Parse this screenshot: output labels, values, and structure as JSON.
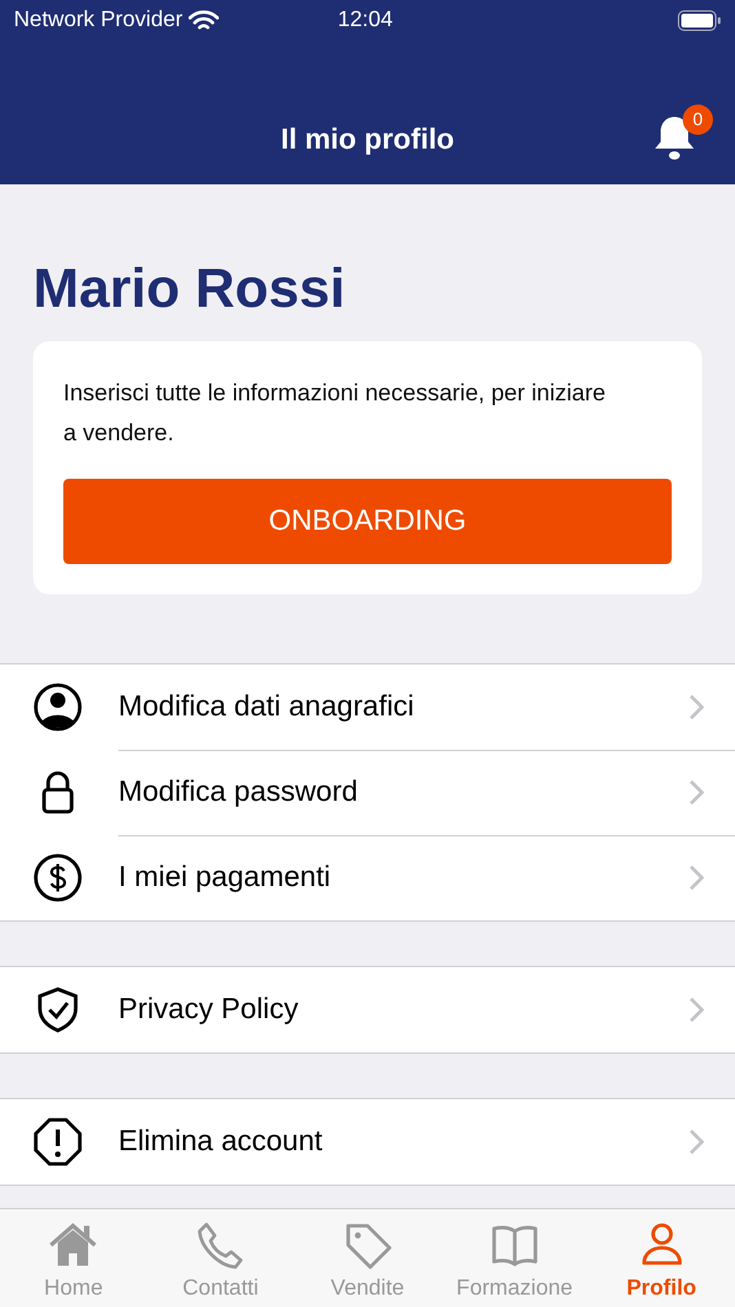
{
  "status_bar": {
    "carrier": "Network Provider",
    "time": "12:04"
  },
  "header": {
    "title": "Il mio profilo",
    "notification_count": "0"
  },
  "profile": {
    "name": "Mario Rossi"
  },
  "onboarding_card": {
    "text": "Inserisci tutte le informazioni necessarie, per iniziare a vendere.",
    "button": "ONBOARDING"
  },
  "menu_sections": [
    {
      "items": [
        {
          "kind": "person",
          "label": "Modifica dati anagrafici"
        },
        {
          "kind": "lock",
          "label": "Modifica password"
        },
        {
          "kind": "dollar",
          "label": "I miei pagamenti"
        }
      ]
    },
    {
      "items": [
        {
          "kind": "shield",
          "label": "Privacy Policy"
        }
      ]
    },
    {
      "items": [
        {
          "kind": "alert",
          "label": "Elimina account"
        }
      ]
    }
  ],
  "tab_bar": [
    {
      "kind": "home",
      "label": "Home",
      "selected": false
    },
    {
      "kind": "phone",
      "label": "Contatti",
      "selected": false
    },
    {
      "kind": "tag",
      "label": "Vendite",
      "selected": false
    },
    {
      "kind": "book",
      "label": "Formazione",
      "selected": false
    },
    {
      "kind": "person",
      "label": "Profilo",
      "selected": true
    }
  ]
}
